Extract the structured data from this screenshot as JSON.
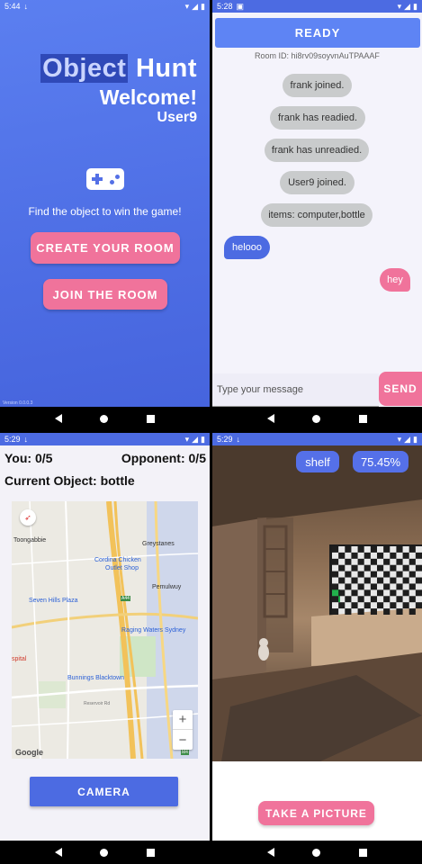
{
  "home": {
    "status_time": "5:44",
    "title_part1": "Object",
    "title_part2": "Hunt",
    "welcome": "Welcome!",
    "username": "User9",
    "tagline": "Find the object to win the game!",
    "create_button": "CREATE YOUR ROOM",
    "join_button": "JOIN THE ROOM",
    "version": "Version 0.0.0.3"
  },
  "lobby": {
    "status_time": "5:28",
    "ready_button": "READY",
    "room_id": "Room ID: hi8rv09soyvnAuTPAAAF",
    "system_messages": [
      "frank joined.",
      "frank has readied.",
      "frank has unreadied.",
      "User9 joined.",
      "items: computer,bottle"
    ],
    "left_message": "helooo",
    "right_message": "hey",
    "input_placeholder": "Type your message",
    "send_button": "SEND"
  },
  "game": {
    "status_time": "5:29",
    "you_score": "You: 0/5",
    "opponent_score": "Opponent: 0/5",
    "current_object": "Current Object: bottle",
    "map_labels": {
      "toongabbie": "Toongabbie",
      "greystanes": "Greystanes",
      "cordina_1": "Cordina Chicken",
      "cordina_2": "Outlet Shop",
      "seven_hills": "Seven Hills Plaza",
      "pemulwuy": "Pemulwuy",
      "raging_waters": "Raging Waters Sydney",
      "hospital": "spital",
      "bunnings": "Bunnings Blacktown",
      "road_a44": "A44",
      "road_m4": "M4",
      "reservoir": "Reservoir Rd",
      "google": "Google"
    },
    "camera_button": "CAMERA"
  },
  "camera": {
    "status_time": "5:29",
    "detected_label": "shelf",
    "confidence": "75.45%",
    "take_picture_button": "TAKE A PICTURE"
  },
  "colors": {
    "primary": "#4c6be2",
    "accent_pink": "#f0739b",
    "bubble_grey": "#c9cbcc"
  }
}
